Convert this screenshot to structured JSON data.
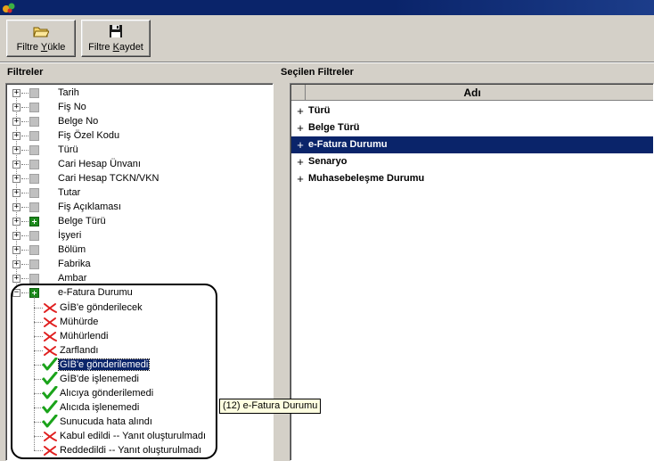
{
  "toolbar": {
    "load_button": {
      "label_pre": "Filtre ",
      "label_u": "Y",
      "label_post": "ükle",
      "icon": "open-folder-icon"
    },
    "save_button": {
      "label_pre": "Filtre ",
      "label_u": "K",
      "label_post": "aydet",
      "icon": "floppy-disk-icon"
    }
  },
  "left_panel": {
    "title": "Filtreler",
    "items": [
      {
        "label": "Tarih",
        "state": "none"
      },
      {
        "label": "Fiş No",
        "state": "none"
      },
      {
        "label": "Belge No",
        "state": "none"
      },
      {
        "label": "Fiş Özel Kodu",
        "state": "none"
      },
      {
        "label": "Türü",
        "state": "none"
      },
      {
        "label": "Cari Hesap Ünvanı",
        "state": "none"
      },
      {
        "label": "Cari Hesap TCKN/VKN",
        "state": "none"
      },
      {
        "label": "Tutar",
        "state": "none"
      },
      {
        "label": "Fiş Açıklaması",
        "state": "none"
      },
      {
        "label": "Belge Türü",
        "state": "active"
      },
      {
        "label": "İşyeri",
        "state": "none"
      },
      {
        "label": "Bölüm",
        "state": "none"
      },
      {
        "label": "Fabrika",
        "state": "none"
      },
      {
        "label": "Ambar",
        "state": "none"
      },
      {
        "label": "e-Fatura Durumu",
        "state": "active",
        "expanded": true
      }
    ],
    "efatura_children": [
      {
        "label": "GİB'e gönderilecek",
        "checked": false
      },
      {
        "label": "Mühürde",
        "checked": false
      },
      {
        "label": "Mühürlendi",
        "checked": false
      },
      {
        "label": "Zarflandı",
        "checked": false
      },
      {
        "label": "GİB'e gönderilemedi",
        "checked": true,
        "focused": true
      },
      {
        "label": "GİB'de işlenemedi",
        "checked": true
      },
      {
        "label": "Alıcıya gönderilemedi",
        "checked": true
      },
      {
        "label": "Alıcıda işlenemedi",
        "checked": true
      },
      {
        "label": "Sunucuda hata alındı",
        "checked": true
      },
      {
        "label": "Kabul edildi -- Yanıt oluşturulmadı",
        "checked": false
      },
      {
        "label": "Reddedildi -- Yanıt oluşturulmadı",
        "checked": false
      }
    ],
    "tooltip": "(12) e-Fatura Durumu"
  },
  "right_panel": {
    "title": "Seçilen Filtreler",
    "column_header": "Adı",
    "rows": [
      {
        "label": "Türü",
        "selected": false
      },
      {
        "label": "Belge Türü",
        "selected": false
      },
      {
        "label": "e-Fatura Durumu",
        "selected": true
      },
      {
        "label": "Senaryo",
        "selected": false
      },
      {
        "label": "Muhasebeleşme Durumu",
        "selected": false
      }
    ]
  },
  "colors": {
    "selection": "#0a246a",
    "check": "#1aa31a",
    "cross": "#e02020",
    "window_bg": "#d4d0c8"
  }
}
